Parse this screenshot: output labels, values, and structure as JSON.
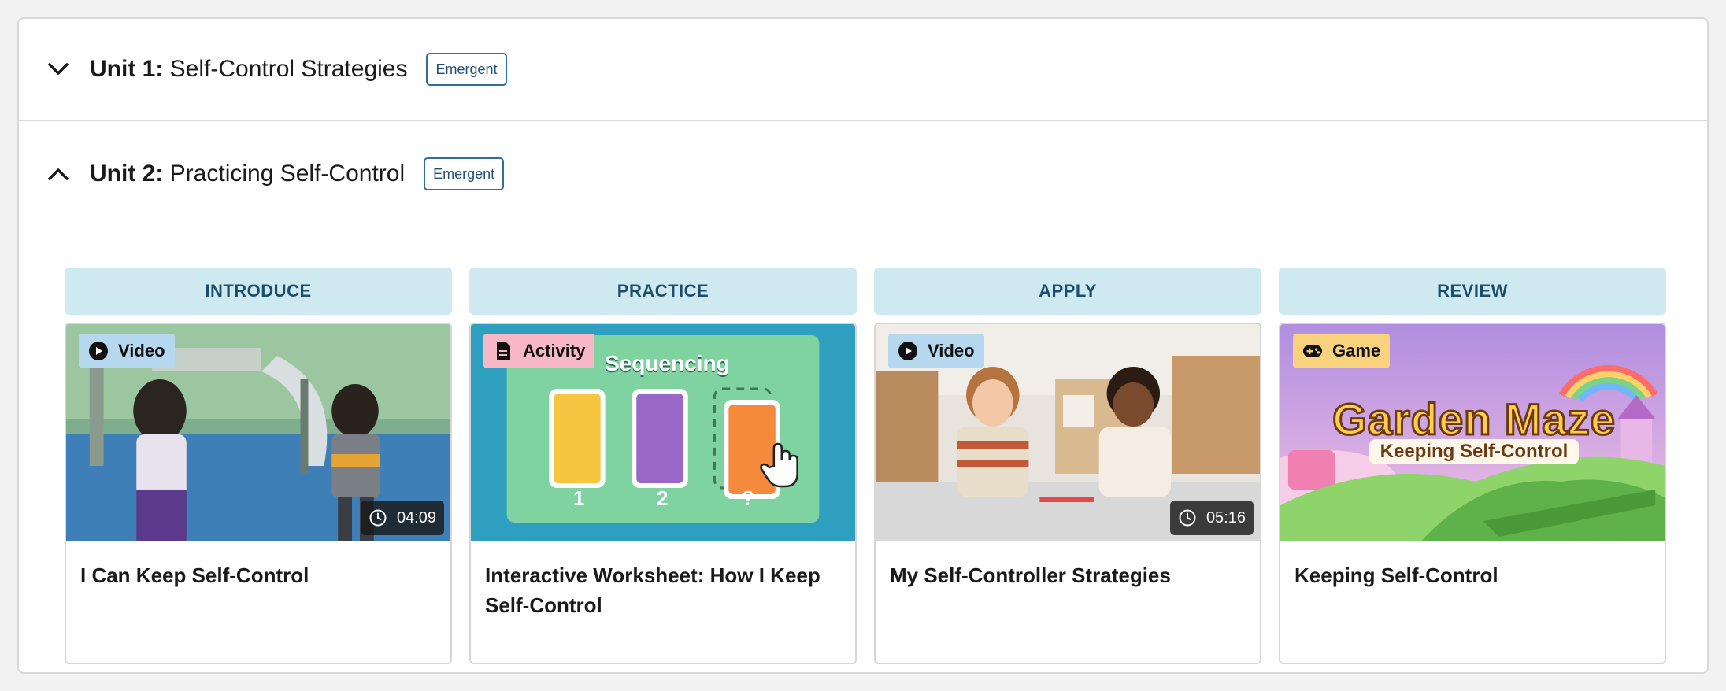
{
  "units": [
    {
      "number_label": "Unit 1:",
      "title": "Self-Control Strategies",
      "badge": "Emergent",
      "expanded": false
    },
    {
      "number_label": "Unit 2:",
      "title": "Practicing Self-Control",
      "badge": "Emergent",
      "expanded": true
    }
  ],
  "lessons": [
    {
      "phase": "INTRODUCE",
      "type": "Video",
      "type_icon": "play-icon",
      "duration": "04:09",
      "title": "I Can Keep Self-Control"
    },
    {
      "phase": "PRACTICE",
      "type": "Activity",
      "type_icon": "document-icon",
      "title": "Interactive Worksheet: How I Keep Self-Control",
      "thumb": {
        "heading": "Sequencing",
        "labels": [
          "1",
          "2",
          "?"
        ]
      }
    },
    {
      "phase": "APPLY",
      "type": "Video",
      "type_icon": "play-icon",
      "duration": "05:16",
      "title": "My Self-Controller Strategies"
    },
    {
      "phase": "REVIEW",
      "type": "Game",
      "type_icon": "gamepad-icon",
      "title": "Keeping Self-Control",
      "thumb": {
        "heading": "Garden Maze",
        "subheading": "Keeping Self-Control"
      }
    }
  ],
  "colors": {
    "phase_bg": "#cfe9f1",
    "badge_border": "#2e6f9e",
    "video_tag": "#b6d8ee",
    "activity_tag": "#f7b7c6",
    "game_tag": "#f8d27c"
  }
}
